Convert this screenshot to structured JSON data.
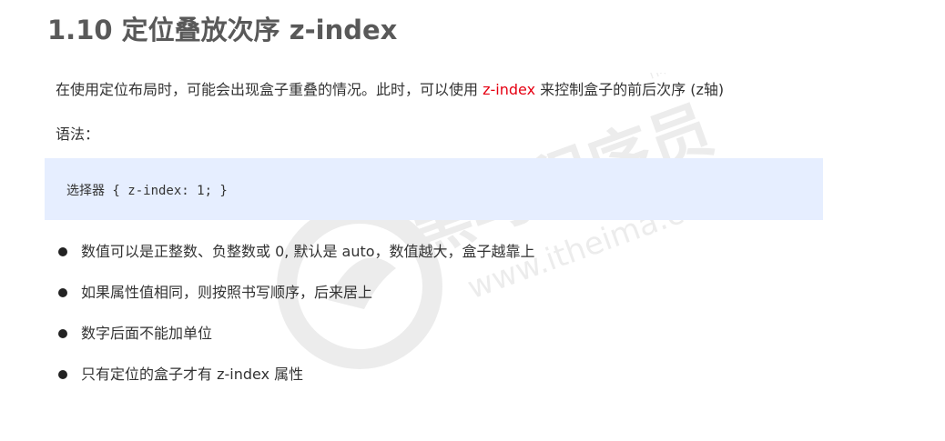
{
  "title": "1.10 定位叠放次序 z-index",
  "intro": {
    "before": "在使用定位布局时，可能会出现盒子重叠的情况。此时，可以使用 ",
    "highlight": "z-index",
    "after": " 来控制盒子的前后次序 (z轴)",
    "highlight_color": "#e60012"
  },
  "syntax_label": "语法：",
  "code": "选择器 { z-index: 1; }",
  "bullets": [
    "数值可以是正整数、负整数或 0, 默认是 auto，数值越大，盒子越靠上",
    "如果属性值相同，则按照书写顺序，后来居上",
    "数字后面不能加单位",
    "只有定位的盒子才有 z-index 属性"
  ],
  "watermark": {
    "brand": "黑马程序员",
    "trademark": "TM",
    "url": "www.itheima.com",
    "logo_icon": "horse-logo-icon"
  },
  "colors": {
    "title": "#595959",
    "code_background": "#e6eeff",
    "text": "#333333"
  }
}
